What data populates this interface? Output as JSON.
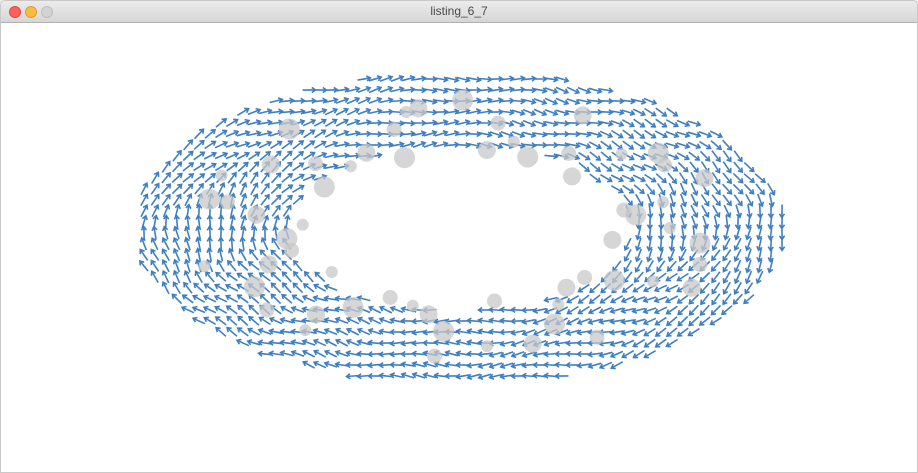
{
  "window": {
    "title": "listing_6_7"
  },
  "colors": {
    "arrow": "#3f7fc1",
    "particle": "#c8c8c8",
    "canvas_bg": "#ffffff"
  }
}
